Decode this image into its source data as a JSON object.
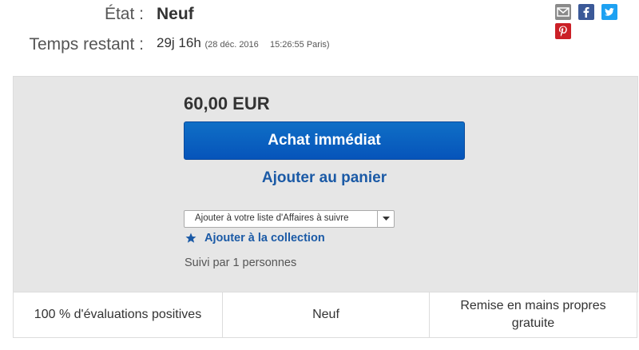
{
  "item_details": {
    "condition_label": "État :",
    "condition_value": "Neuf",
    "time_left_label": "Temps restant :",
    "time_left_value": "29j 16h",
    "end_date": "(28 déc. 2016",
    "end_time": "15:26:55 Paris)"
  },
  "share": {
    "icons": [
      "mail-icon",
      "facebook-icon",
      "twitter-icon",
      "pinterest-icon"
    ],
    "colors": {
      "mail": "#8a8a8a",
      "facebook": "#3b5998",
      "twitter": "#1da1f2",
      "pinterest": "#cb2027"
    }
  },
  "purchase": {
    "price": "60,00 EUR",
    "buy_now_label": "Achat immédiat",
    "add_to_cart_label": "Ajouter au panier",
    "watchlist_option": "Ajouter à votre liste d'Affaires à suivre",
    "collection_label": "Ajouter à la collection",
    "followers_text": "Suivi par 1 personnes"
  },
  "highlights": {
    "feedback": "100 % d'évaluations positives",
    "condition": "Neuf",
    "pickup_line1": "Remise en mains propres",
    "pickup_line2": "gratuite"
  },
  "colors": {
    "accent_blue": "#0654ba",
    "link_blue": "#1b5aa6",
    "panel_bg": "#e6e6e6"
  }
}
